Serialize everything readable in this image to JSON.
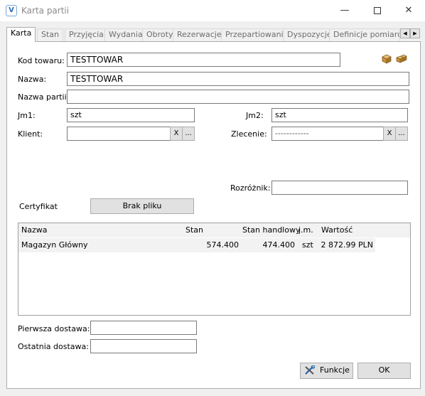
{
  "window": {
    "title": "Karta partii",
    "minimize_glyph": "—",
    "close_glyph": "✕",
    "app_icon_letter": "V"
  },
  "tabs": [
    {
      "label": "Karta",
      "active": true
    },
    {
      "label": "Stan"
    },
    {
      "label": "Przyjęcia"
    },
    {
      "label": "Wydania"
    },
    {
      "label": "Obroty"
    },
    {
      "label": "Rezerwacje"
    },
    {
      "label": "Przepartiowania"
    },
    {
      "label": "Dyspozycje"
    },
    {
      "label": "Definicje pomiarów"
    }
  ],
  "tab_scroll": {
    "left": "◀",
    "right": "▶"
  },
  "form": {
    "kod_towaru_label": "Kod towaru:",
    "kod_towaru_value": "TESTTOWAR",
    "nazwa_label": "Nazwa:",
    "nazwa_value": "TESTTOWAR",
    "nazwa_partii_label": "Nazwa partii:",
    "nazwa_partii_value": "",
    "jm1_label": "Jm1:",
    "jm1_value": "szt",
    "jm2_label": "Jm2:",
    "jm2_value": "szt",
    "klient_label": "Klient:",
    "klient_value": "",
    "zlecenie_label": "Zlecenie:",
    "zlecenie_value": "------------",
    "clear_label": "X",
    "browse_label": "...",
    "rozroznik_label": "Rozróżnik:",
    "rozroznik_value": "",
    "certyfikat_label": "Certyfikat",
    "brak_pliku_label": "Brak pliku",
    "pierwsza_dostawa_label": "Pierwsza dostawa:",
    "pierwsza_dostawa_value": "",
    "ostatnia_dostawa_label": "Ostatnia dostawa:",
    "ostatnia_dostawa_value": ""
  },
  "grid": {
    "columns": [
      "Nazwa",
      "Stan",
      "Stan handlowy",
      "j.m.",
      "Wartość"
    ],
    "rows": [
      {
        "nazwa": "Magazyn Główny",
        "stan": "574.400",
        "stan_handlowy": "474.400",
        "jm": "szt",
        "wartosc": "2 872.99 PLN"
      }
    ]
  },
  "buttons": {
    "funkcje": "Funkcje",
    "ok": "OK"
  },
  "icons": {
    "box_icons": [
      "box-icon",
      "boxes-icon"
    ],
    "funkcje_icon": "tools-icon"
  }
}
